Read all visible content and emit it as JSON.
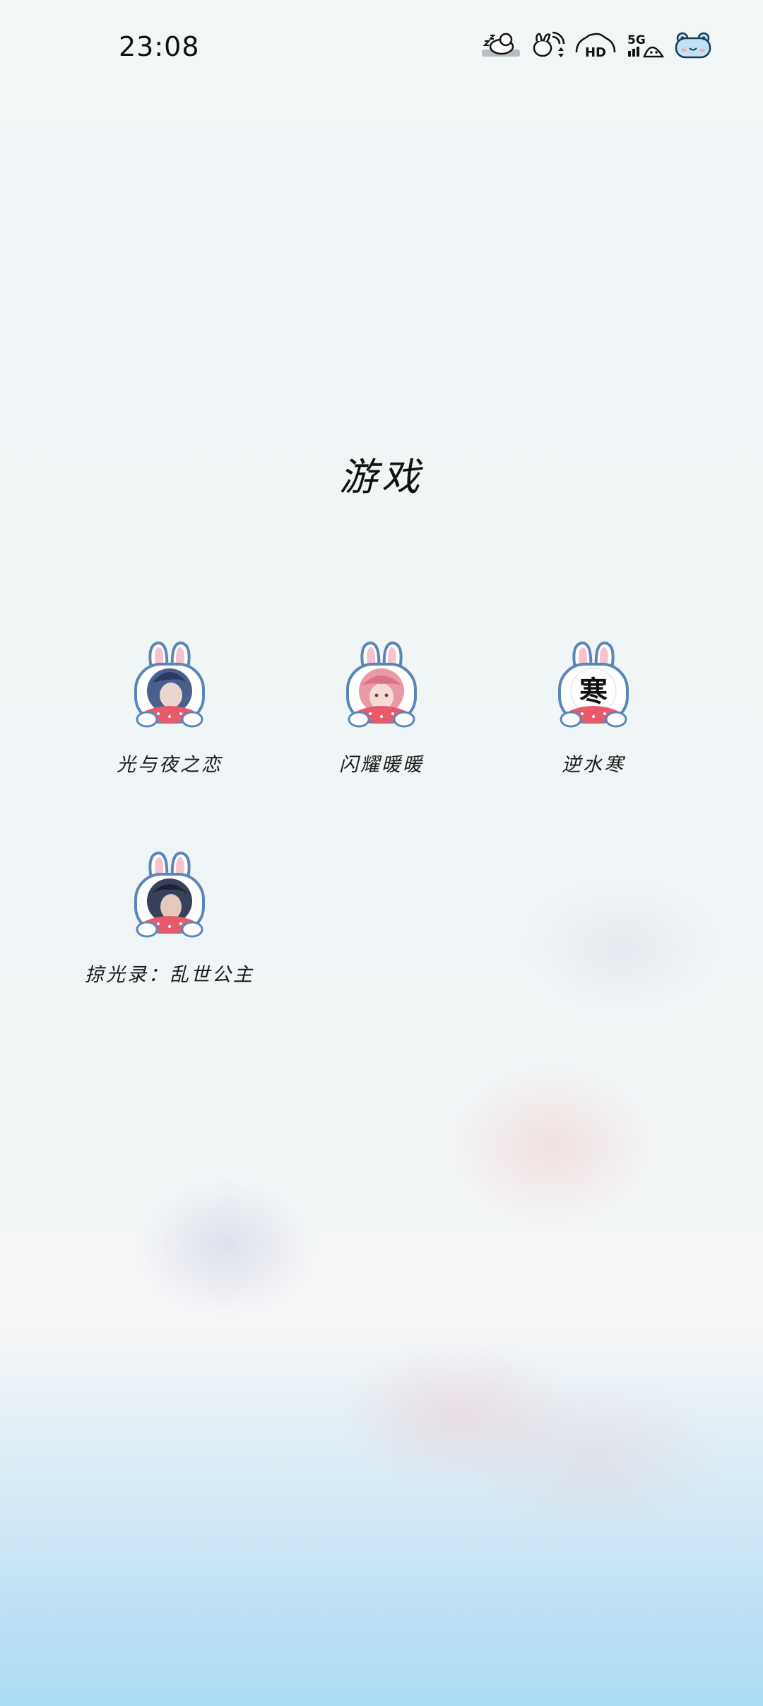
{
  "status_bar": {
    "time": "23:08",
    "icons": [
      "do-not-disturb-icon",
      "wifi-icon",
      "hd-call-icon",
      "signal-5g-icon",
      "battery-icon"
    ],
    "network_label": "5G",
    "hd_label": "HD"
  },
  "folder": {
    "title": "游戏",
    "apps": [
      {
        "label": "光与夜之恋",
        "icon": "avatar-blue-hair-man",
        "avatar_color": "#4a5f8e"
      },
      {
        "label": "闪耀暖暖",
        "icon": "avatar-pink-hair-girl",
        "avatar_color": "#e99aa6"
      },
      {
        "label": "逆水寒",
        "icon": "calligraphy-character",
        "avatar_color": "#ffffff",
        "glyph": "寒"
      },
      {
        "label": "掠光录：乱世公主",
        "icon": "avatar-dark-hair-man",
        "avatar_color": "#38405a"
      }
    ]
  },
  "theme": {
    "rabbit_outline": "#5b86b8",
    "rabbit_ear_inner": "#f6c3cd",
    "rabbit_belly": "#e85a6a"
  }
}
